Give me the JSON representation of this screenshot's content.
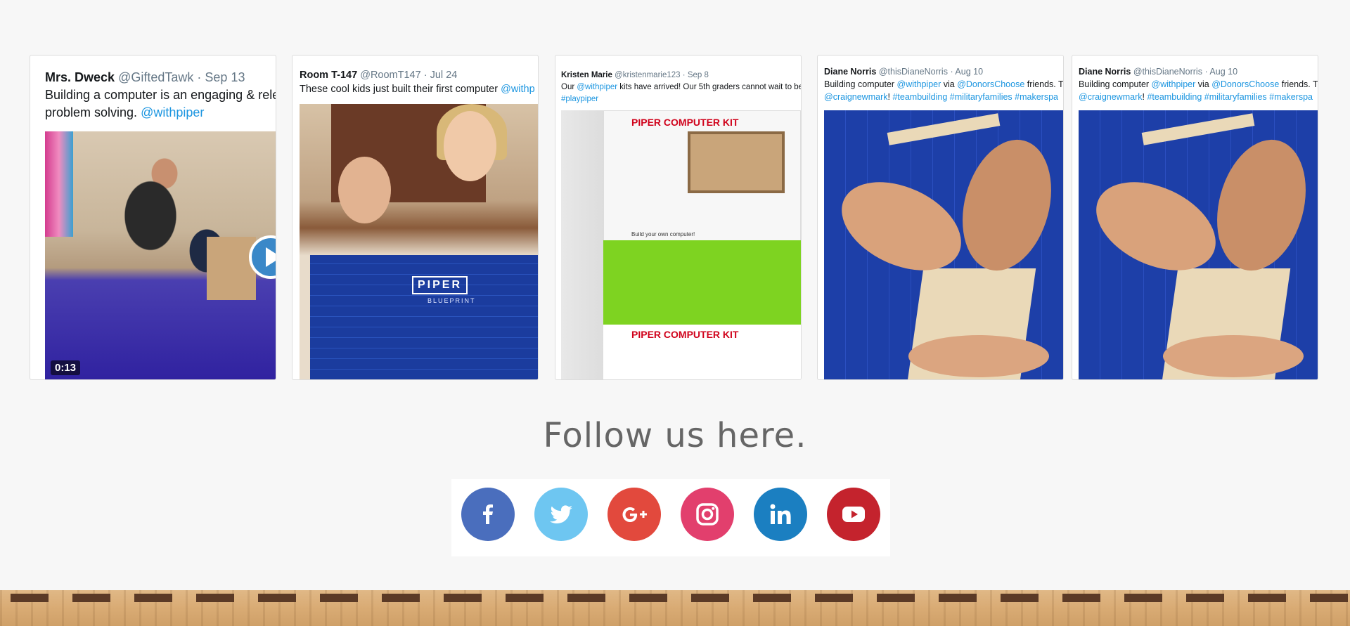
{
  "tweets": [
    {
      "name": "Mrs. Dweck",
      "handle": "@GiftedTawk",
      "date": "Sep 13",
      "text_line1": "Building a computer is an engaging & rele",
      "text_line2_plain": "problem solving.",
      "text_line2_mention": "@withpiper",
      "video_duration": "0:13"
    },
    {
      "name": "Room T-147",
      "handle": "@RoomT147",
      "date": "Jul 24",
      "text_plain": "These cool kids just built their first computer",
      "text_mention": "@withp",
      "blueprint_title": "PIPER",
      "blueprint_sub": "BLUEPRINT"
    },
    {
      "name": "Kristen Marie",
      "handle": "@kristenmarie123",
      "date": "Sep 8",
      "text_before": "Our",
      "text_mention": "@withpiper",
      "text_after": "kits have arrived! Our 5th graders cannot wait to be",
      "hashtag": "#playpiper",
      "box_title": "PIPER COMPUTER KIT",
      "box_tagline": "Build your own computer!"
    },
    {
      "name": "Diane Norris",
      "handle": "@thisDianeNorris",
      "date": "Aug 10",
      "text_before": "Building computer",
      "mention1": "@withpiper",
      "text_via": "via",
      "mention2": "@DonorsChoose",
      "text_after": "friends. T",
      "line2_mention": "@craignewmark",
      "line2_excl": "!",
      "hashtags": "#teambuilding #militaryfamilies #makerspa"
    },
    {
      "name": "Diane Norris",
      "handle": "@thisDianeNorris",
      "date": "Aug 10",
      "text_before": "Building computer",
      "mention1": "@withpiper",
      "text_via": "via",
      "mention2": "@DonorsChoose",
      "text_after": "friends. T",
      "line2_mention": "@craignewmark",
      "line2_excl": "!",
      "hashtags": "#teambuilding #militaryfamilies #makerspa"
    }
  ],
  "follow": {
    "title": "Follow us here."
  },
  "social": [
    {
      "name": "facebook",
      "icon": "facebook-icon",
      "color": "#4a6ebd"
    },
    {
      "name": "twitter",
      "icon": "twitter-icon",
      "color": "#6ec6f1"
    },
    {
      "name": "google-plus",
      "icon": "google-plus-icon",
      "color": "#e2493d"
    },
    {
      "name": "instagram",
      "icon": "instagram-icon",
      "color": "#e23f6d"
    },
    {
      "name": "linkedin",
      "icon": "linkedin-icon",
      "color": "#1b7fc1"
    },
    {
      "name": "youtube",
      "icon": "youtube-icon",
      "color": "#c4232d"
    }
  ],
  "separator": "·"
}
